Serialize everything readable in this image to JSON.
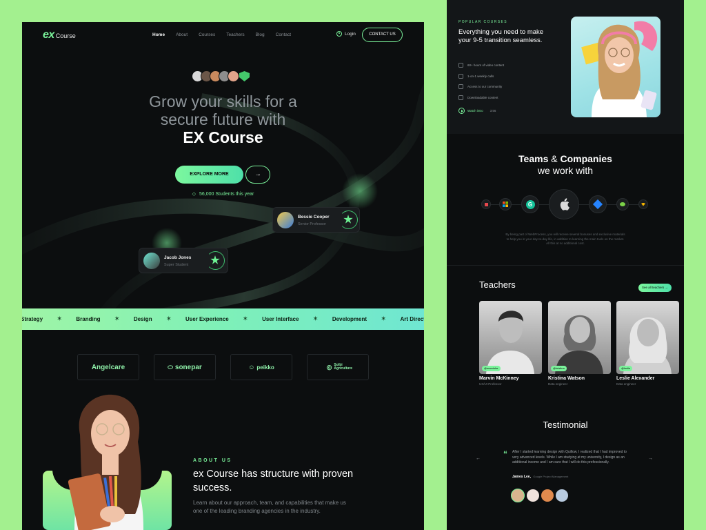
{
  "nav": {
    "logo_mark": "ex",
    "logo_word": "Course",
    "links": [
      "Home",
      "About",
      "Courses",
      "Teachers",
      "Blog",
      "Contact"
    ],
    "login": "Login",
    "contact": "CONTACT US"
  },
  "hero": {
    "title_line1": "Grow your skills for a",
    "title_line2": "secure future with",
    "title_strong": "EX Course",
    "explore": "EXPLORE MORE",
    "arrow": "→",
    "students": "56,000 Students this year"
  },
  "cards": [
    {
      "name": "Bessie Cooper",
      "role": "Senior Professor"
    },
    {
      "name": "Jacob Jones",
      "role": "Super Student"
    }
  ],
  "ticker": [
    "Strategy",
    "Branding",
    "Design",
    "User Experience",
    "User Interface",
    "Development",
    "Art Direction"
  ],
  "partners": [
    "Angelcare",
    "sonepar",
    "peikko",
    "Solbi Agriculture"
  ],
  "about": {
    "label": "ABOUT US",
    "title": "ex Course has structure with proven success.",
    "text": "Learn about our approach, team, and capabilities that make us one of the leading branding agencies in the industry."
  },
  "popular": {
    "label": "POPULAR COURSES",
    "title": "Everything you need to make your 9-5 transition seamless.",
    "items": [
      "60+ hours of video content",
      "1-on-1 weekly calls",
      "Access to our community",
      "Downloadable content"
    ],
    "watch": "Watch intro",
    "time": "3:56"
  },
  "teams": {
    "title_a": "Teams",
    "title_amp": " & ",
    "title_b": "Companies",
    "title_c": "we work with",
    "text": "By being part of WebProcess, you will receive several bonuses and exclusive materials to help you in your day-to-day life, in addition to learning the main tools on the market. All this at no additional cost."
  },
  "teachers": {
    "title": "Teachers",
    "see_all": "See all teachers →",
    "list": [
      {
        "tag": "@marvinhe",
        "name": "Marvin McKinney",
        "role": "UX/UI Professor"
      },
      {
        "tag": "@kristina",
        "name": "Kristina Watson",
        "role": "Data engineer"
      },
      {
        "tag": "@leslie",
        "name": "Leslie Alexander",
        "role": "Data engineer"
      }
    ]
  },
  "testimonial": {
    "title": "Testimonial",
    "quote_mark": "“",
    "text": "After I started learning design with Quillow, I realized that I had improved to very advanced levels. While I am studying at my university, I design as an additional income and I am sure that I will do this professionally.",
    "author": "James Lee,",
    "author_role": "Google Project Management",
    "prev": "←",
    "next": "→"
  },
  "colors": {
    "accent": "#7bf39b",
    "bg": "#0c0e0f",
    "page": "#a3f08f"
  }
}
